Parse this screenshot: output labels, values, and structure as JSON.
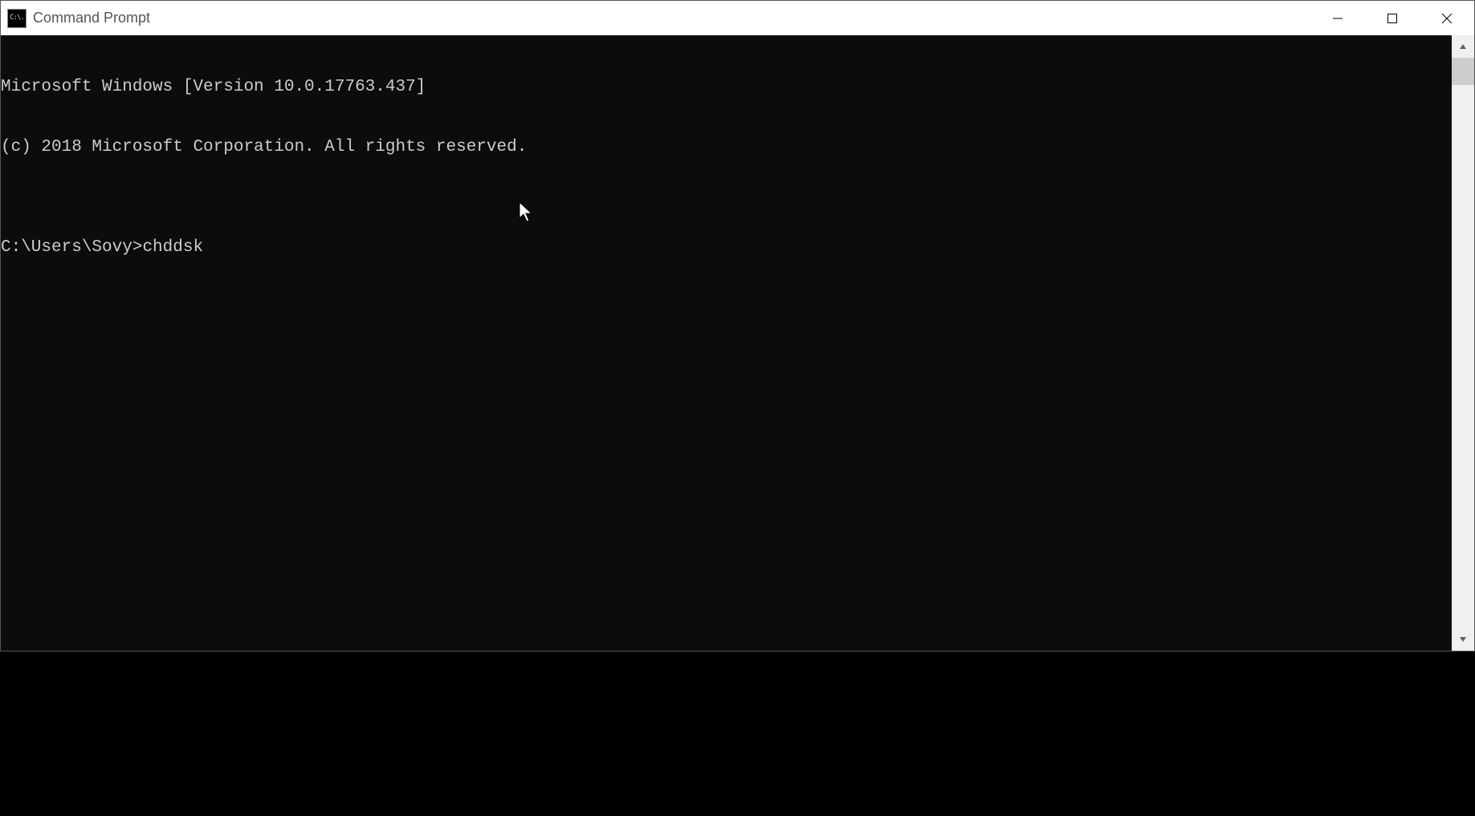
{
  "window": {
    "title": "Command Prompt",
    "app_icon_text": "C:\\."
  },
  "terminal": {
    "lines": [
      "Microsoft Windows [Version 10.0.17763.437]",
      "(c) 2018 Microsoft Corporation. All rights reserved.",
      ""
    ],
    "prompt": "C:\\Users\\Sovy>",
    "command": "chddsk"
  }
}
